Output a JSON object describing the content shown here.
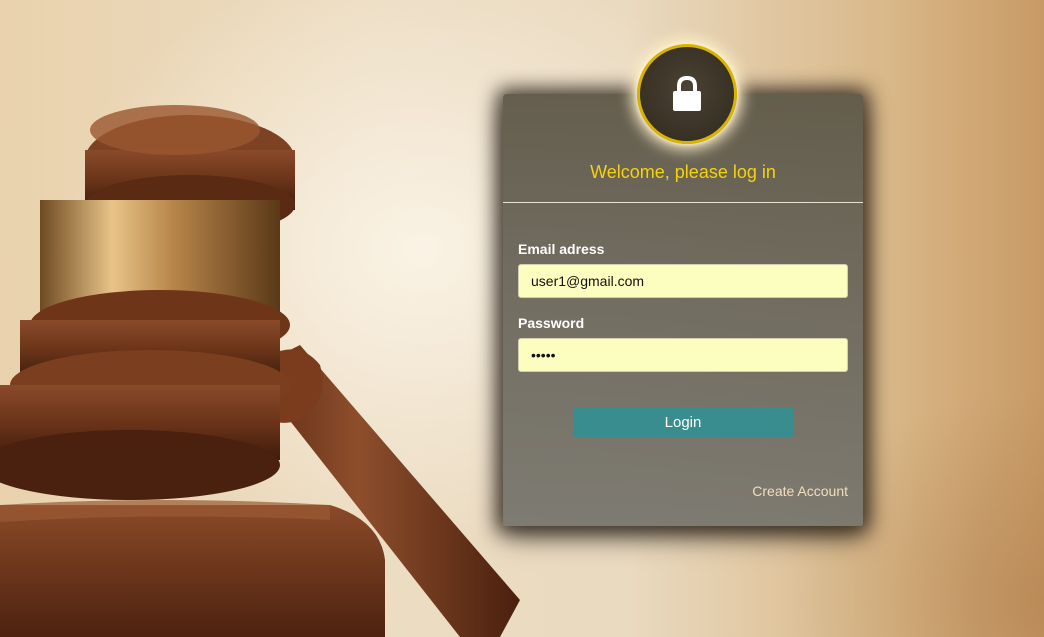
{
  "login_card": {
    "heading": "Welcome, please log in",
    "email_label": "Email adress",
    "email_value": "user1@gmail.com",
    "password_label": "Password",
    "password_value": "abcde",
    "login_button": "Login",
    "create_account_link": "Create Account"
  },
  "icons": {
    "badge": "lock-icon",
    "background": "gavel-image"
  },
  "colors": {
    "heading": "#f6d20e",
    "input_background": "#fbfebe",
    "login_button": "#3a8d8f",
    "badge_ring": "#d8b400",
    "link": "#f1dfbf"
  }
}
